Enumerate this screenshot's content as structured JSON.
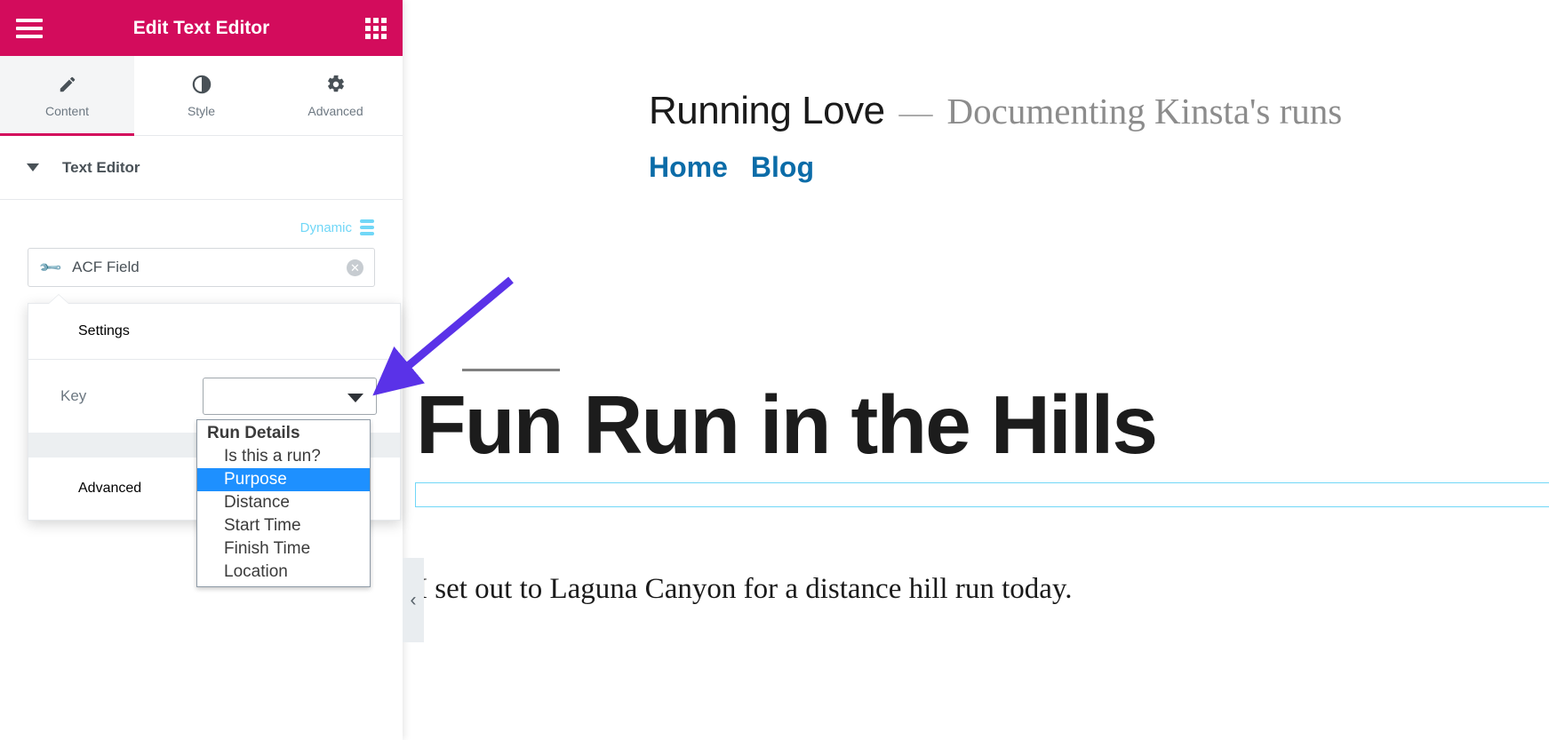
{
  "panel": {
    "header": {
      "title": "Edit Text Editor",
      "menu_icon": "hamburger-menu-icon",
      "grid_icon": "apps-grid-icon",
      "background": "#d30c5c"
    },
    "tabs": [
      {
        "label": "Content",
        "icon": "pencil-icon",
        "active": true
      },
      {
        "label": "Style",
        "icon": "half-circle-contrast-icon",
        "active": false
      },
      {
        "label": "Advanced",
        "icon": "gear-icon",
        "active": false
      }
    ],
    "sections": {
      "text_editor": {
        "label": "Text Editor",
        "expanded": true
      }
    },
    "dynamic": {
      "label": "Dynamic",
      "icon": "database-stack-icon",
      "color": "#71d7f7"
    },
    "dynamic_tag": {
      "label": "ACF Field",
      "icon": "wrench-icon",
      "remove_icon": "close-circle-icon"
    },
    "popover": {
      "settings_label": "Settings",
      "settings_expanded": true,
      "key_label": "Key",
      "key_value": "",
      "advanced_label": "Advanced",
      "advanced_expanded": false,
      "options": [
        {
          "label": "Run Details",
          "type": "group",
          "selected": false
        },
        {
          "label": "Is this a run?",
          "type": "option",
          "selected": false
        },
        {
          "label": "Purpose",
          "type": "option",
          "selected": true
        },
        {
          "label": "Distance",
          "type": "option",
          "selected": false
        },
        {
          "label": "Start Time",
          "type": "option",
          "selected": false
        },
        {
          "label": "Finish Time",
          "type": "option",
          "selected": false
        },
        {
          "label": "Location",
          "type": "option",
          "selected": false
        }
      ],
      "highlight_color": "#1e90ff"
    },
    "collapse_handle": "‹"
  },
  "preview": {
    "site_title": "Running Love",
    "site_dash": "—",
    "site_tagline": "Documenting Kinsta's runs",
    "nav": [
      {
        "label": "Home"
      },
      {
        "label": "Blog"
      }
    ],
    "nav_color": "#0b6ca8",
    "post_title": "Fun Run in the Hills",
    "post_body": "I set out to Laguna Canyon for a distance hill run today.",
    "selection_border_color": "#71d7f7"
  },
  "annotation": {
    "arrow_color": "#5a32e8",
    "points_to": "key-select-dropdown"
  }
}
